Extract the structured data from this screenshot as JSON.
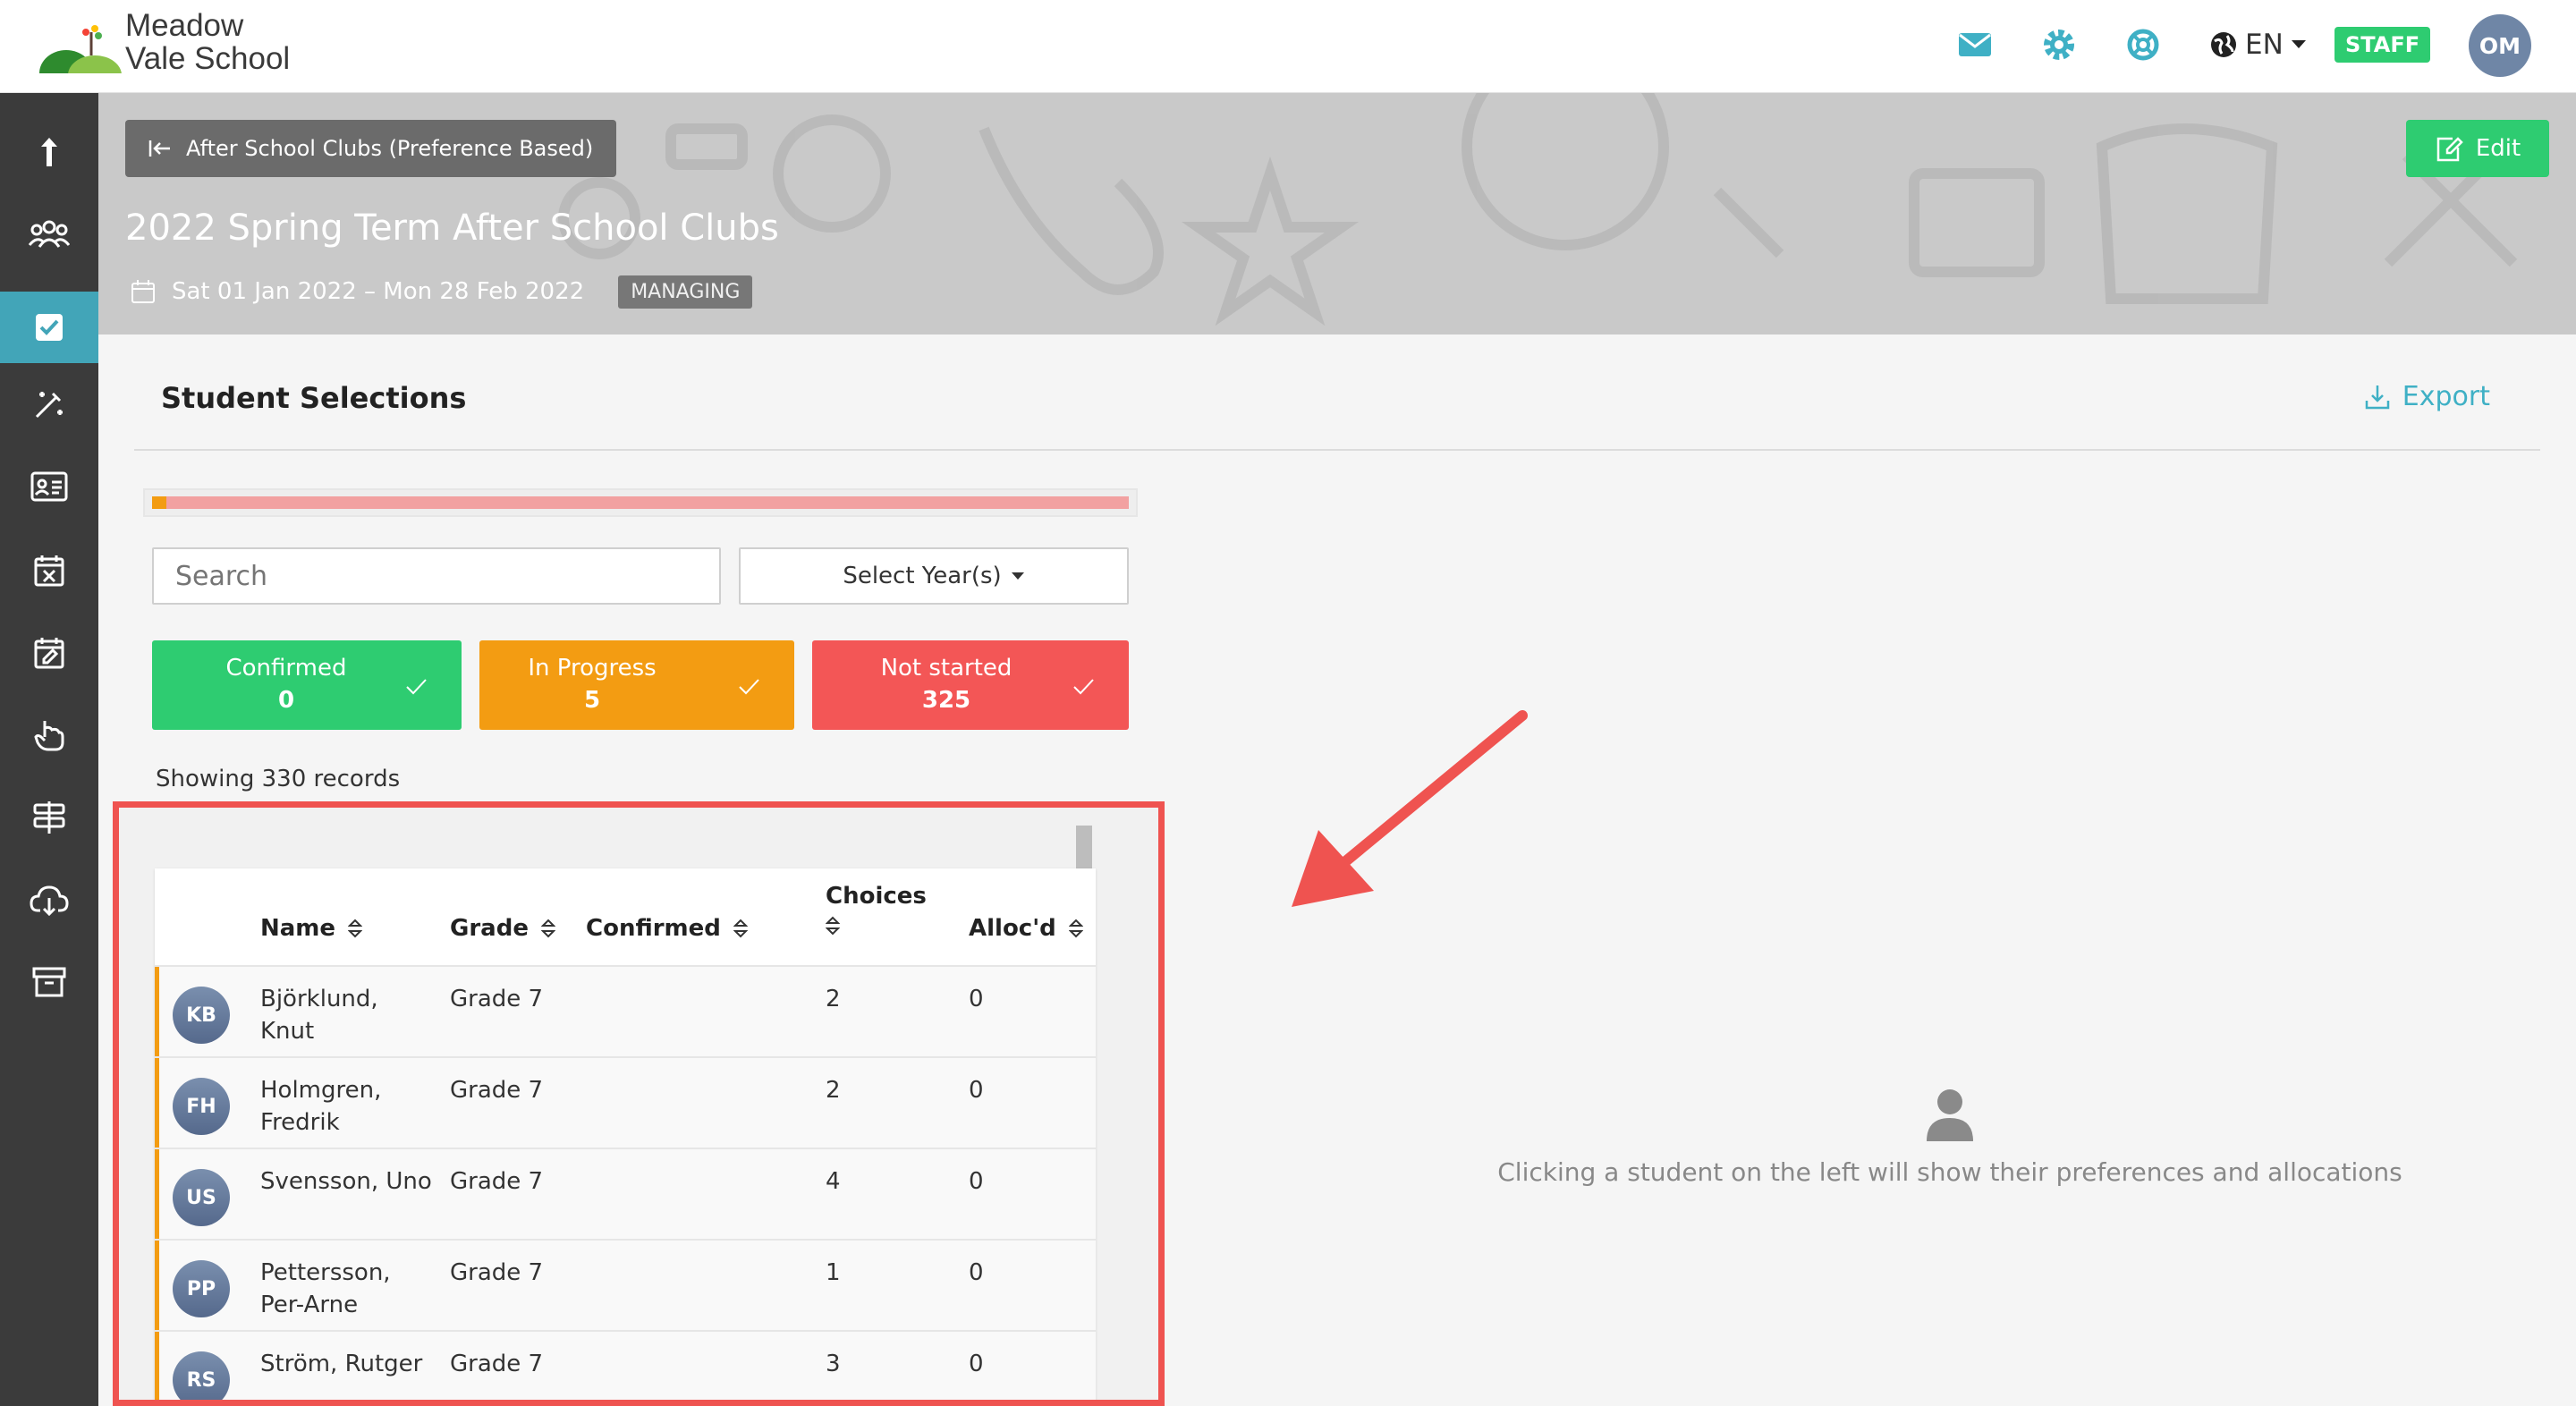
{
  "brand": {
    "name_line1": "Meadow",
    "name_line2": "Vale School"
  },
  "header": {
    "language": "EN",
    "role_badge": "STAFF",
    "user_initials": "OM"
  },
  "banner": {
    "back_label": "After School Clubs (Preference Based)",
    "edit_label": "Edit",
    "title": "2022 Spring Term After School Clubs",
    "date_range": "Sat 01 Jan 2022 – Mon 28 Feb 2022",
    "status_badge": "MANAGING"
  },
  "section": {
    "title": "Student Selections",
    "export_label": "Export"
  },
  "progress": {
    "completed_fraction": 0.015
  },
  "filters": {
    "search_placeholder": "Search",
    "year_select_label": "Select Year(s)"
  },
  "stats": [
    {
      "label": "Confirmed",
      "value": "0",
      "color": "#2ecc71"
    },
    {
      "label": "In Progress",
      "value": "5",
      "color": "#f39c12"
    },
    {
      "label": "Not started",
      "value": "325",
      "color": "#f35656"
    }
  ],
  "records_text": "Showing 330 records",
  "table": {
    "columns": [
      "Name",
      "Grade",
      "Confirmed",
      "Choices",
      "Alloc'd"
    ],
    "rows": [
      {
        "initials": "KB",
        "name": "Björklund, Knut",
        "grade": "Grade 7",
        "confirmed": "",
        "choices": "2",
        "allocated": "0"
      },
      {
        "initials": "FH",
        "name": "Holmgren, Fredrik",
        "grade": "Grade 7",
        "confirmed": "",
        "choices": "2",
        "allocated": "0"
      },
      {
        "initials": "US",
        "name": "Svensson, Uno",
        "grade": "Grade 7",
        "confirmed": "",
        "choices": "4",
        "allocated": "0"
      },
      {
        "initials": "PP",
        "name": "Pettersson, Per-Arne",
        "grade": "Grade 7",
        "confirmed": "",
        "choices": "1",
        "allocated": "0"
      },
      {
        "initials": "RS",
        "name": "Ström, Rutger",
        "grade": "Grade 7",
        "confirmed": "",
        "choices": "3",
        "allocated": "0"
      }
    ]
  },
  "empty_state": {
    "message": "Clicking a student on the left will show their preferences and allocations"
  },
  "colors": {
    "accent": "#42a5b8",
    "success": "#2ecc71",
    "warning": "#f39c12",
    "danger": "#f35656",
    "annotation": "#ef5350"
  },
  "sidebar_icons": [
    "upload-icon",
    "people-icon",
    "checkbox-icon",
    "magic-wand-icon",
    "id-card-icon",
    "calendar-x-icon",
    "calendar-edit-icon",
    "pointer-hand-icon",
    "signpost-icon",
    "cloud-download-icon",
    "archive-icon"
  ]
}
